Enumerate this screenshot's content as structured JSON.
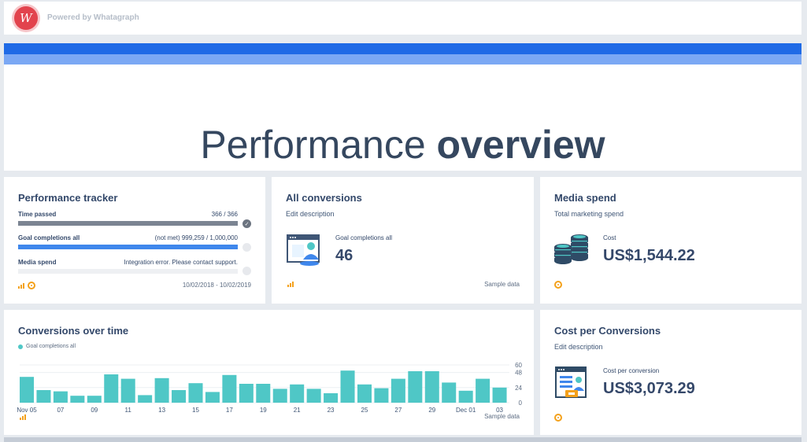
{
  "branding": {
    "logo_letter": "W",
    "powered_by": "Powered by Whatagraph"
  },
  "hero": {
    "title_light": "Performance ",
    "title_bold": "overview"
  },
  "tracker": {
    "title": "Performance tracker",
    "rows": [
      {
        "label": "Time passed",
        "value": "366 / 366",
        "progress": 1.0,
        "color": "#7b8492",
        "done": true
      },
      {
        "label": "Goal completions all",
        "value": "(not met) 999,259 / 1,000,000",
        "progress": 0.9993,
        "color": "#3f87ec",
        "done": false
      },
      {
        "label": "Media spend",
        "value": "Integration error. Please contact support.",
        "progress": 0,
        "color": "#eef0f3",
        "done": false
      }
    ],
    "date_range": "10/02/2018 - 10/02/2019"
  },
  "all_conversions": {
    "title": "All conversions",
    "subtitle": "Edit description",
    "metric_label": "Goal completions all",
    "metric_value": "46",
    "footnote": "Sample data"
  },
  "media_spend": {
    "title": "Media spend",
    "subtitle": "Total marketing spend",
    "metric_label": "Cost",
    "metric_value": "US$1,544.22"
  },
  "conversions_over_time": {
    "title": "Conversions over time",
    "footnote": "Sample data"
  },
  "cost_per_conversion": {
    "title": "Cost per Conversions",
    "subtitle": "Edit description",
    "metric_label": "Cost per conversion",
    "metric_value": "US$3,073.29"
  },
  "colors": {
    "accent": "#1f6ae6",
    "bar": "#4fc7c6",
    "title": "#33486a",
    "warning": "#f4a11b"
  },
  "chart_data": {
    "type": "bar",
    "series": [
      {
        "name": "Goal completions all",
        "values": [
          41,
          20,
          18,
          11,
          11,
          45,
          38,
          12,
          39,
          20,
          31,
          17,
          44,
          30,
          30,
          22,
          29,
          22,
          15,
          51,
          29,
          23,
          38,
          50,
          50,
          32,
          19,
          38,
          24
        ]
      }
    ],
    "x_tick_labels": [
      "Nov 05",
      "07",
      "09",
      "11",
      "13",
      "15",
      "17",
      "19",
      "21",
      "23",
      "25",
      "27",
      "29",
      "Dec 01",
      "03"
    ],
    "y_tick_labels": [
      "60",
      "48",
      "24",
      "0"
    ],
    "ylim": [
      0,
      60
    ],
    "legend_position": "top-left",
    "grid": true
  }
}
